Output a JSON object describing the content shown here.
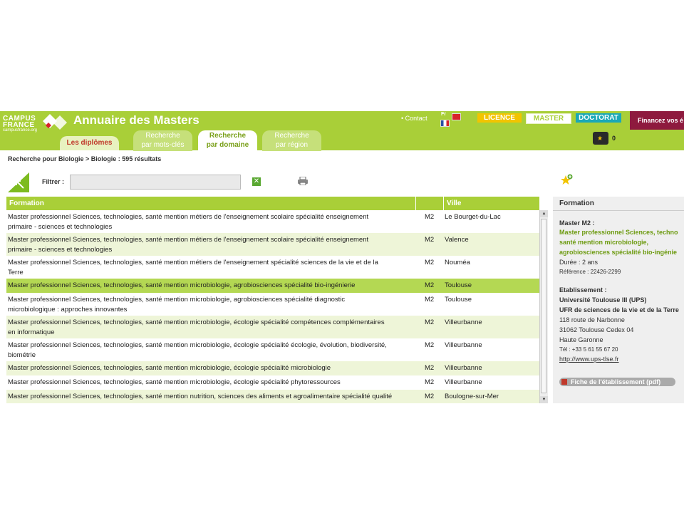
{
  "header": {
    "logo_line1": "CAMPUS",
    "logo_line2": "FRANCE",
    "logo_line3": "campusfrance.org",
    "title": "Annuaire des Masters",
    "contact": "• Contact",
    "lang_label": "Fr",
    "levels": {
      "licence": "LICENCE",
      "master": "MASTER",
      "doctorat": "DOCTORAT"
    },
    "finance": "Financez vos é",
    "cart_count": "0"
  },
  "tabs": {
    "diplomes": "Les diplômes",
    "mots_cles": [
      "Recherche",
      "par mots-clés"
    ],
    "domaine": [
      "Recherche",
      "par domaine"
    ],
    "region": [
      "Recherche",
      "par région"
    ]
  },
  "breadcrumb": "Recherche pour Biologie > Biologie : 595 résultats",
  "filter": {
    "label": "Filtrer :",
    "value": "",
    "placeholder": ""
  },
  "table": {
    "headers": {
      "formation": "Formation",
      "ville": "Ville"
    },
    "rows": [
      {
        "formation": [
          "Master professionnel Sciences, technologies, santé mention métiers de l'enseignement scolaire spécialité enseignement",
          "primaire - sciences et technologies"
        ],
        "niveau": "M2",
        "ville": "Le Bourget-du-Lac"
      },
      {
        "formation": [
          "Master professionnel Sciences, technologies, santé mention métiers de l'enseignement scolaire spécialité enseignement",
          "primaire - sciences et technologies"
        ],
        "niveau": "M2",
        "ville": "Valence"
      },
      {
        "formation": [
          "Master professionnel Sciences, technologies, santé mention métiers de l'enseignement spécialité sciences de la vie et de la",
          "Terre"
        ],
        "niveau": "M2",
        "ville": "Nouméa"
      },
      {
        "formation": [
          "Master professionnel Sciences, technologies, santé mention microbiologie, agrobiosciences spécialité bio-ingénierie"
        ],
        "niveau": "M2",
        "ville": "Toulouse"
      },
      {
        "formation": [
          "Master professionnel Sciences, technologies, santé mention microbiologie, agrobiosciences spécialité diagnostic",
          "microbiologique : approches innovantes"
        ],
        "niveau": "M2",
        "ville": "Toulouse"
      },
      {
        "formation": [
          "Master professionnel Sciences, technologies, santé mention microbiologie, écologie spécialité compétences complémentaires",
          "en informatique"
        ],
        "niveau": "M2",
        "ville": "Villeurbanne"
      },
      {
        "formation": [
          "Master professionnel Sciences, technologies, santé mention microbiologie, écologie spécialité écologie, évolution, biodiversité,",
          "biométrie"
        ],
        "niveau": "M2",
        "ville": "Villeurbanne"
      },
      {
        "formation": [
          "Master professionnel Sciences, technologies, santé mention microbiologie, écologie spécialité microbiologie"
        ],
        "niveau": "M2",
        "ville": "Villeurbanne"
      },
      {
        "formation": [
          "Master professionnel Sciences, technologies, santé mention microbiologie, écologie spécialité phytoressources"
        ],
        "niveau": "M2",
        "ville": "Villeurbanne"
      },
      {
        "formation": [
          "Master professionnel Sciences, technologies, santé mention nutrition, sciences des aliments et agroalimentaire spécialité qualité"
        ],
        "niveau": "M2",
        "ville": "Boulogne-sur-Mer"
      }
    ]
  },
  "detail": {
    "header": "Formation",
    "level": "Master M2 :",
    "title_lines": [
      "Master professionnel Sciences, techno",
      "santé mention microbiologie,",
      "agrobiosciences spécialité bio-ingénie"
    ],
    "duree": "Durée : 2 ans",
    "reference": "Référence : 22426-2299",
    "etab_label": "Etablissement :",
    "etab_name": "Université Toulouse III (UPS)",
    "etab_ufr": "UFR de sciences de la vie et de la Terre",
    "address": [
      "118 route de Narbonne",
      "31062 Toulouse Cedex 04",
      "Haute Garonne"
    ],
    "tel": "Tél : +33 5 61 55 67 20",
    "url": "http://www.ups-tlse.fr",
    "pdf_button": "Fiche de l'établissement (pdf)"
  },
  "colors": {
    "brand_green": "#a9cf38",
    "selected_row": "#b4d853",
    "alt_row": "#eef5d8",
    "finance": "#8e1a3e"
  }
}
